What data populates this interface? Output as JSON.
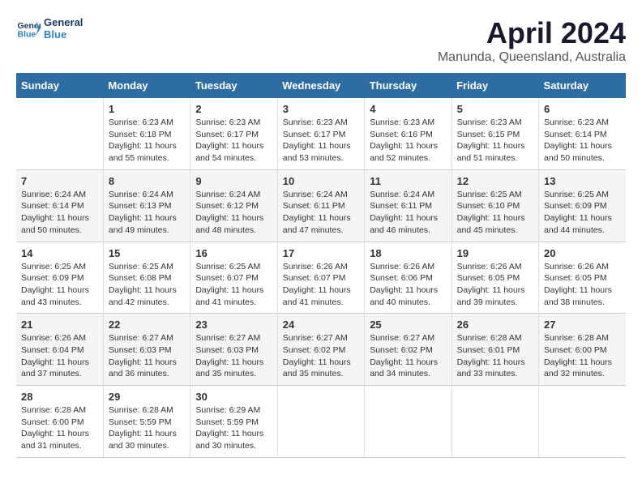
{
  "header": {
    "logo_line1": "General",
    "logo_line2": "Blue",
    "month_title": "April 2024",
    "location": "Manunda, Queensland, Australia"
  },
  "days_header": [
    "Sunday",
    "Monday",
    "Tuesday",
    "Wednesday",
    "Thursday",
    "Friday",
    "Saturday"
  ],
  "weeks": [
    [
      {
        "day": "",
        "content": ""
      },
      {
        "day": "1",
        "content": "Sunrise: 6:23 AM\nSunset: 6:18 PM\nDaylight: 11 hours\nand 55 minutes."
      },
      {
        "day": "2",
        "content": "Sunrise: 6:23 AM\nSunset: 6:17 PM\nDaylight: 11 hours\nand 54 minutes."
      },
      {
        "day": "3",
        "content": "Sunrise: 6:23 AM\nSunset: 6:17 PM\nDaylight: 11 hours\nand 53 minutes."
      },
      {
        "day": "4",
        "content": "Sunrise: 6:23 AM\nSunset: 6:16 PM\nDaylight: 11 hours\nand 52 minutes."
      },
      {
        "day": "5",
        "content": "Sunrise: 6:23 AM\nSunset: 6:15 PM\nDaylight: 11 hours\nand 51 minutes."
      },
      {
        "day": "6",
        "content": "Sunrise: 6:23 AM\nSunset: 6:14 PM\nDaylight: 11 hours\nand 50 minutes."
      }
    ],
    [
      {
        "day": "7",
        "content": ""
      },
      {
        "day": "8",
        "content": "Sunrise: 6:24 AM\nSunset: 6:13 PM\nDaylight: 11 hours\nand 49 minutes."
      },
      {
        "day": "9",
        "content": "Sunrise: 6:24 AM\nSunset: 6:12 PM\nDaylight: 11 hours\nand 48 minutes."
      },
      {
        "day": "10",
        "content": "Sunrise: 6:24 AM\nSunset: 6:11 PM\nDaylight: 11 hours\nand 47 minutes."
      },
      {
        "day": "11",
        "content": "Sunrise: 6:24 AM\nSunset: 6:11 PM\nDaylight: 11 hours\nand 46 minutes."
      },
      {
        "day": "12",
        "content": "Sunrise: 6:25 AM\nSunset: 6:10 PM\nDaylight: 11 hours\nand 45 minutes."
      },
      {
        "day": "13",
        "content": "Sunrise: 6:25 AM\nSunset: 6:09 PM\nDaylight: 11 hours\nand 44 minutes."
      }
    ],
    [
      {
        "day": "14",
        "content": ""
      },
      {
        "day": "15",
        "content": "Sunrise: 6:25 AM\nSunset: 6:08 PM\nDaylight: 11 hours\nand 42 minutes."
      },
      {
        "day": "16",
        "content": "Sunrise: 6:25 AM\nSunset: 6:07 PM\nDaylight: 11 hours\nand 41 minutes."
      },
      {
        "day": "17",
        "content": "Sunrise: 6:26 AM\nSunset: 6:07 PM\nDaylight: 11 hours\nand 41 minutes."
      },
      {
        "day": "18",
        "content": "Sunrise: 6:26 AM\nSunset: 6:06 PM\nDaylight: 11 hours\nand 40 minutes."
      },
      {
        "day": "19",
        "content": "Sunrise: 6:26 AM\nSunset: 6:05 PM\nDaylight: 11 hours\nand 39 minutes."
      },
      {
        "day": "20",
        "content": "Sunrise: 6:26 AM\nSunset: 6:05 PM\nDaylight: 11 hours\nand 38 minutes."
      }
    ],
    [
      {
        "day": "21",
        "content": ""
      },
      {
        "day": "22",
        "content": "Sunrise: 6:27 AM\nSunset: 6:03 PM\nDaylight: 11 hours\nand 36 minutes."
      },
      {
        "day": "23",
        "content": "Sunrise: 6:27 AM\nSunset: 6:03 PM\nDaylight: 11 hours\nand 35 minutes."
      },
      {
        "day": "24",
        "content": "Sunrise: 6:27 AM\nSunset: 6:02 PM\nDaylight: 11 hours\nand 35 minutes."
      },
      {
        "day": "25",
        "content": "Sunrise: 6:27 AM\nSunset: 6:02 PM\nDaylight: 11 hours\nand 34 minutes."
      },
      {
        "day": "26",
        "content": "Sunrise: 6:28 AM\nSunset: 6:01 PM\nDaylight: 11 hours\nand 33 minutes."
      },
      {
        "day": "27",
        "content": "Sunrise: 6:28 AM\nSunset: 6:00 PM\nDaylight: 11 hours\nand 32 minutes."
      }
    ],
    [
      {
        "day": "28",
        "content": "Sunrise: 6:28 AM\nSunset: 6:00 PM\nDaylight: 11 hours\nand 31 minutes."
      },
      {
        "day": "29",
        "content": "Sunrise: 6:28 AM\nSunset: 5:59 PM\nDaylight: 11 hours\nand 30 minutes."
      },
      {
        "day": "30",
        "content": "Sunrise: 6:29 AM\nSunset: 5:59 PM\nDaylight: 11 hours\nand 30 minutes."
      },
      {
        "day": "",
        "content": ""
      },
      {
        "day": "",
        "content": ""
      },
      {
        "day": "",
        "content": ""
      },
      {
        "day": "",
        "content": ""
      }
    ]
  ],
  "week7_sunday": "Sunrise: 6:24 AM\nSunset: 6:14 PM\nDaylight: 11 hours\nand 50 minutes.",
  "week14_sunday": "Sunrise: 6:25 AM\nSunset: 6:09 PM\nDaylight: 11 hours\nand 43 minutes.",
  "week21_sunday": "Sunrise: 6:26 AM\nSunset: 6:04 PM\nDaylight: 11 hours\nand 37 minutes."
}
